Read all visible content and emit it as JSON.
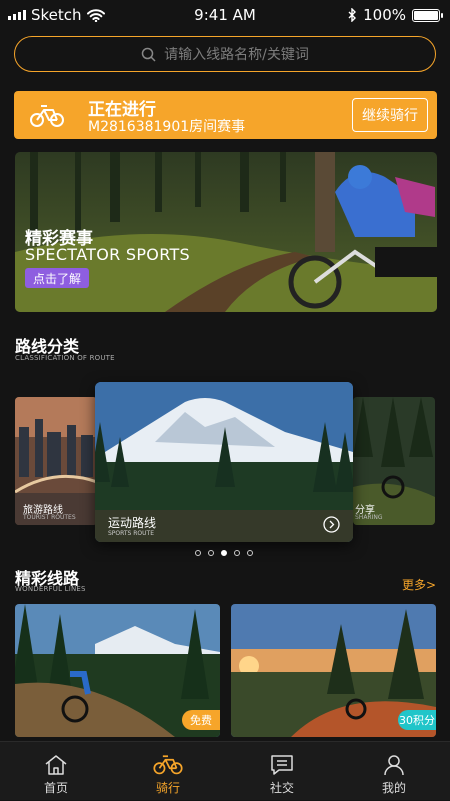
{
  "status_bar": {
    "carrier": "Sketch",
    "time": "9:41 AM",
    "battery": "100%",
    "battery_level": 1.0
  },
  "search": {
    "placeholder": "请输入线路名称/关键词"
  },
  "ongoing": {
    "title": "正在进行",
    "subtitle": "M2816381901房间赛事",
    "button": "继续骑行"
  },
  "banner": {
    "title": "精彩赛事",
    "subtitle": "SPECTATOR SPORTS",
    "button": "点击了解"
  },
  "route_class": {
    "title": "路线分类",
    "subtitle": "CLASSIFICATION OF ROUTE",
    "left": {
      "label": "旅游路线",
      "sub": "TOURIST ROUTES"
    },
    "center": {
      "label": "运动路线",
      "sub": "SPORTS ROUTE"
    },
    "right": {
      "label": "分享",
      "sub": "SHARING"
    },
    "dots_count": 5,
    "active_dot": 2
  },
  "wonderful": {
    "title": "精彩线路",
    "subtitle": "WONDERFUL LINES",
    "more": "更多>",
    "cards": [
      {
        "tag": "免费"
      },
      {
        "tag": "30积分"
      }
    ]
  },
  "tabs": [
    {
      "label": "首页",
      "icon": "home-icon"
    },
    {
      "label": "骑行",
      "icon": "bike-icon"
    },
    {
      "label": "社交",
      "icon": "chat-icon"
    },
    {
      "label": "我的",
      "icon": "person-icon"
    }
  ],
  "colors": {
    "accent": "#f6a52a",
    "purple": "#8e5ee0",
    "teal": "#21c5c9"
  }
}
